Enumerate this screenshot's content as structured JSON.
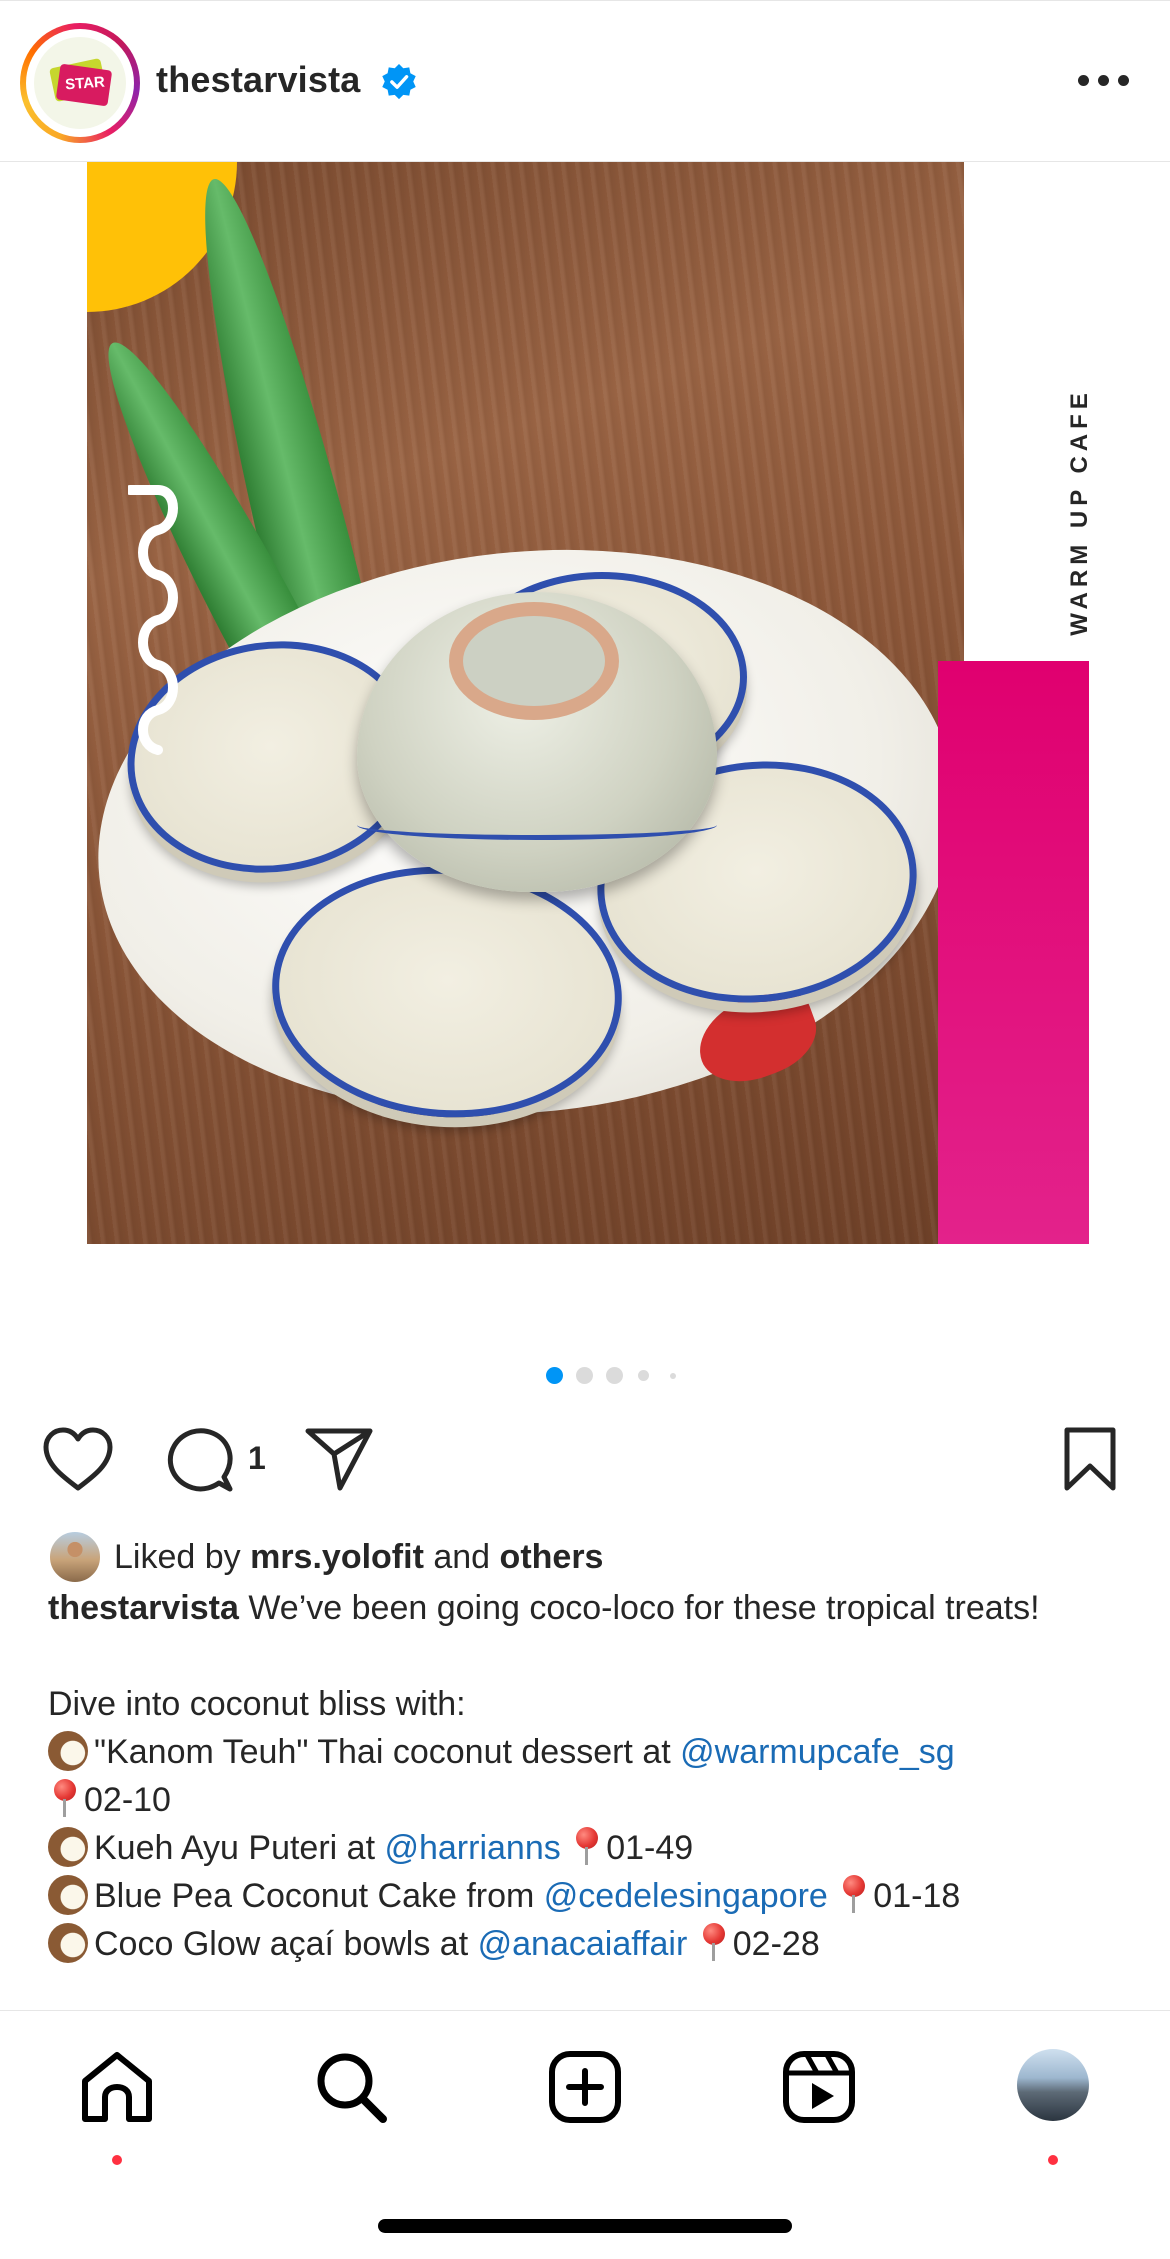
{
  "header": {
    "username": "thestarvista",
    "avatar_logo_text": "STAR",
    "verified_icon": "verified-badge-icon",
    "more_icon": "more-options-icon"
  },
  "post": {
    "side_label": "WARM UP CAFE",
    "carousel": {
      "total": 5,
      "active_index": 0
    }
  },
  "actions": {
    "comment_count": "1"
  },
  "likes": {
    "prefix": "Liked by",
    "user": "mrs.yolofit",
    "conjunction": "and",
    "others": "others"
  },
  "caption": {
    "author": "thestarvista",
    "text": "We’ve been going coco-loco for these tropical treats!",
    "intro": "Dive into coconut bliss with:",
    "items": [
      {
        "text": "\"Kanom Teuh\" Thai coconut dessert at",
        "mention": "@warmupcafe_sg",
        "location": "02-10"
      },
      {
        "text": "Kueh Ayu Puteri at",
        "mention": "@harrianns",
        "location": "01-49"
      },
      {
        "text": "Blue Pea Coconut Cake from",
        "mention": "@cedelesingapore",
        "location": "01-18"
      },
      {
        "text": "Coco Glow açaí bowls at",
        "mention": "@anacaiaffair",
        "location": "02-28"
      }
    ]
  },
  "colors": {
    "accent_blue": "#0095f6",
    "mention_blue": "#1a6bb5",
    "pink_bar": "#e0006f",
    "yellow": "#ffc107",
    "notification_red": "#ff3040"
  },
  "nav": {
    "items": [
      "home-icon",
      "search-icon",
      "create-icon",
      "reels-icon",
      "profile-avatar"
    ]
  }
}
